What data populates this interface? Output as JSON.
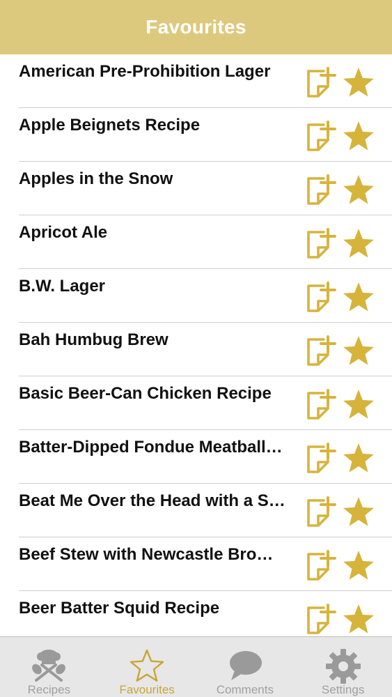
{
  "header": {
    "title": "Favourites"
  },
  "colors": {
    "nav_bar": "#ddc97e",
    "accent_gold": "#d6b43c",
    "tab_inactive": "#a0a0a0",
    "tab_active": "#c9a536"
  },
  "icons": {
    "row_add": "add-note-icon",
    "row_favourite": "star-icon"
  },
  "favourites": [
    {
      "title": "American Pre-Prohibition Lager"
    },
    {
      "title": "Apple Beignets Recipe"
    },
    {
      "title": "Apples in the Snow"
    },
    {
      "title": "Apricot Ale"
    },
    {
      "title": "B.W. Lager"
    },
    {
      "title": "Bah Humbug Brew"
    },
    {
      "title": "Basic Beer-Can Chicken Recipe"
    },
    {
      "title": "Batter-Dipped Fondue Meatball…"
    },
    {
      "title": "Beat Me Over the Head with a S…"
    },
    {
      "title": "Beef Stew with Newcastle Bro…"
    },
    {
      "title": "Beer Batter Squid Recipe"
    }
  ],
  "tabs": [
    {
      "label": "Recipes",
      "icon": "chef-utensils-icon",
      "active": false
    },
    {
      "label": "Favourites",
      "icon": "star-outline-icon",
      "active": true
    },
    {
      "label": "Comments",
      "icon": "speech-bubble-icon",
      "active": false
    },
    {
      "label": "Settings",
      "icon": "gear-icon",
      "active": false
    }
  ]
}
